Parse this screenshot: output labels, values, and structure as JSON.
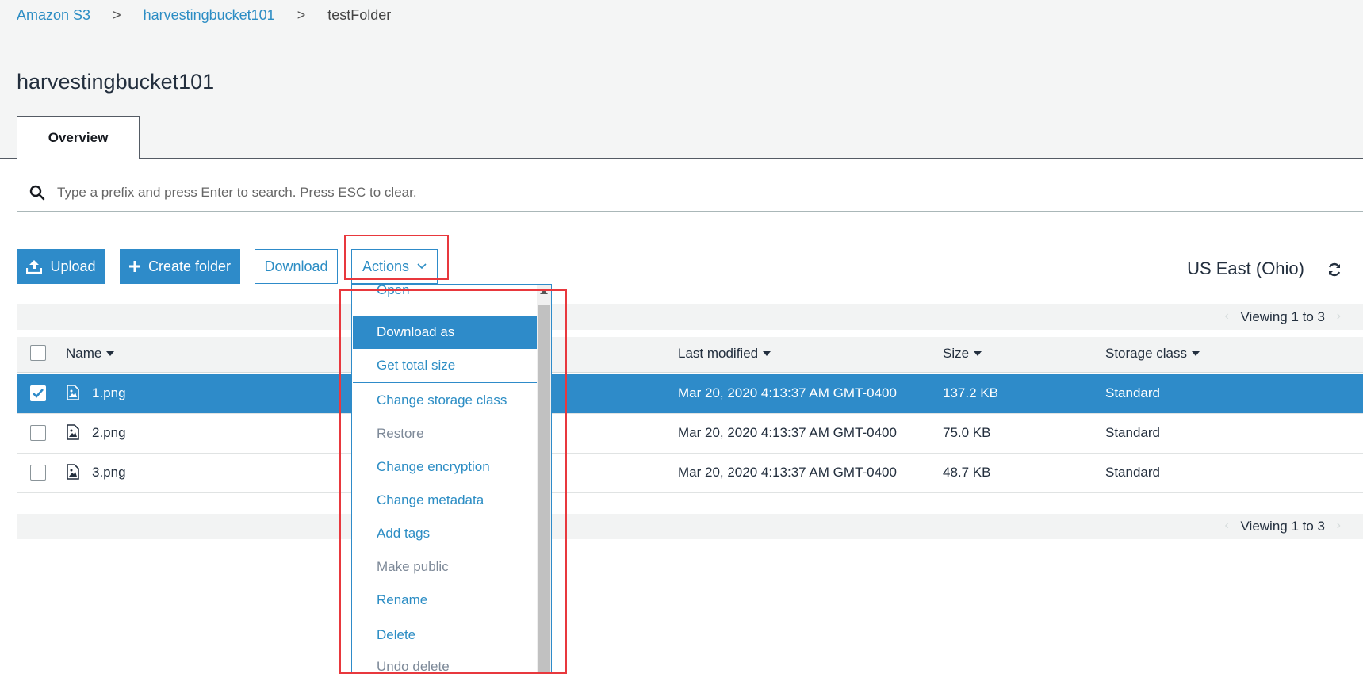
{
  "breadcrumb": {
    "root": "Amazon S3",
    "bucket": "harvestingbucket101",
    "current": "testFolder",
    "separator": ">"
  },
  "page_title": "harvestingbucket101",
  "tabs": [
    {
      "label": "Overview",
      "active": true
    }
  ],
  "search": {
    "placeholder": "Type a prefix and press Enter to search. Press ESC to clear.",
    "value": ""
  },
  "toolbar": {
    "upload_label": "Upload",
    "create_folder_label": "Create folder",
    "download_label": "Download",
    "actions_label": "Actions"
  },
  "region": "US East (Ohio)",
  "pager": {
    "top_text": "Viewing 1 to 3",
    "bottom_text": "Viewing 1 to 3"
  },
  "table": {
    "columns": [
      "Name",
      "Last modified",
      "Size",
      "Storage class"
    ],
    "rows": [
      {
        "name": "1.png",
        "modified": "Mar 20, 2020 4:13:37 AM GMT-0400",
        "size": "137.2 KB",
        "storage": "Standard",
        "selected": true
      },
      {
        "name": "2.png",
        "modified": "Mar 20, 2020 4:13:37 AM GMT-0400",
        "size": "75.0 KB",
        "storage": "Standard",
        "selected": false
      },
      {
        "name": "3.png",
        "modified": "Mar 20, 2020 4:13:37 AM GMT-0400",
        "size": "48.7 KB",
        "storage": "Standard",
        "selected": false
      }
    ]
  },
  "actions_menu": {
    "items": [
      {
        "label": "Open",
        "state": "enabled"
      },
      {
        "label": "Download as",
        "state": "active"
      },
      {
        "label": "Get total size",
        "state": "enabled"
      },
      {
        "label": "Change storage class",
        "state": "enabled"
      },
      {
        "label": "Restore",
        "state": "disabled"
      },
      {
        "label": "Change encryption",
        "state": "enabled"
      },
      {
        "label": "Change metadata",
        "state": "enabled"
      },
      {
        "label": "Add tags",
        "state": "enabled"
      },
      {
        "label": "Make public",
        "state": "disabled"
      },
      {
        "label": "Rename",
        "state": "enabled"
      },
      {
        "label": "Delete",
        "state": "enabled"
      },
      {
        "label": "Undo delete",
        "state": "disabled"
      }
    ]
  },
  "colors": {
    "accent": "#2e8bc9",
    "highlight": "#e8383d",
    "link": "#2c8dc4"
  }
}
